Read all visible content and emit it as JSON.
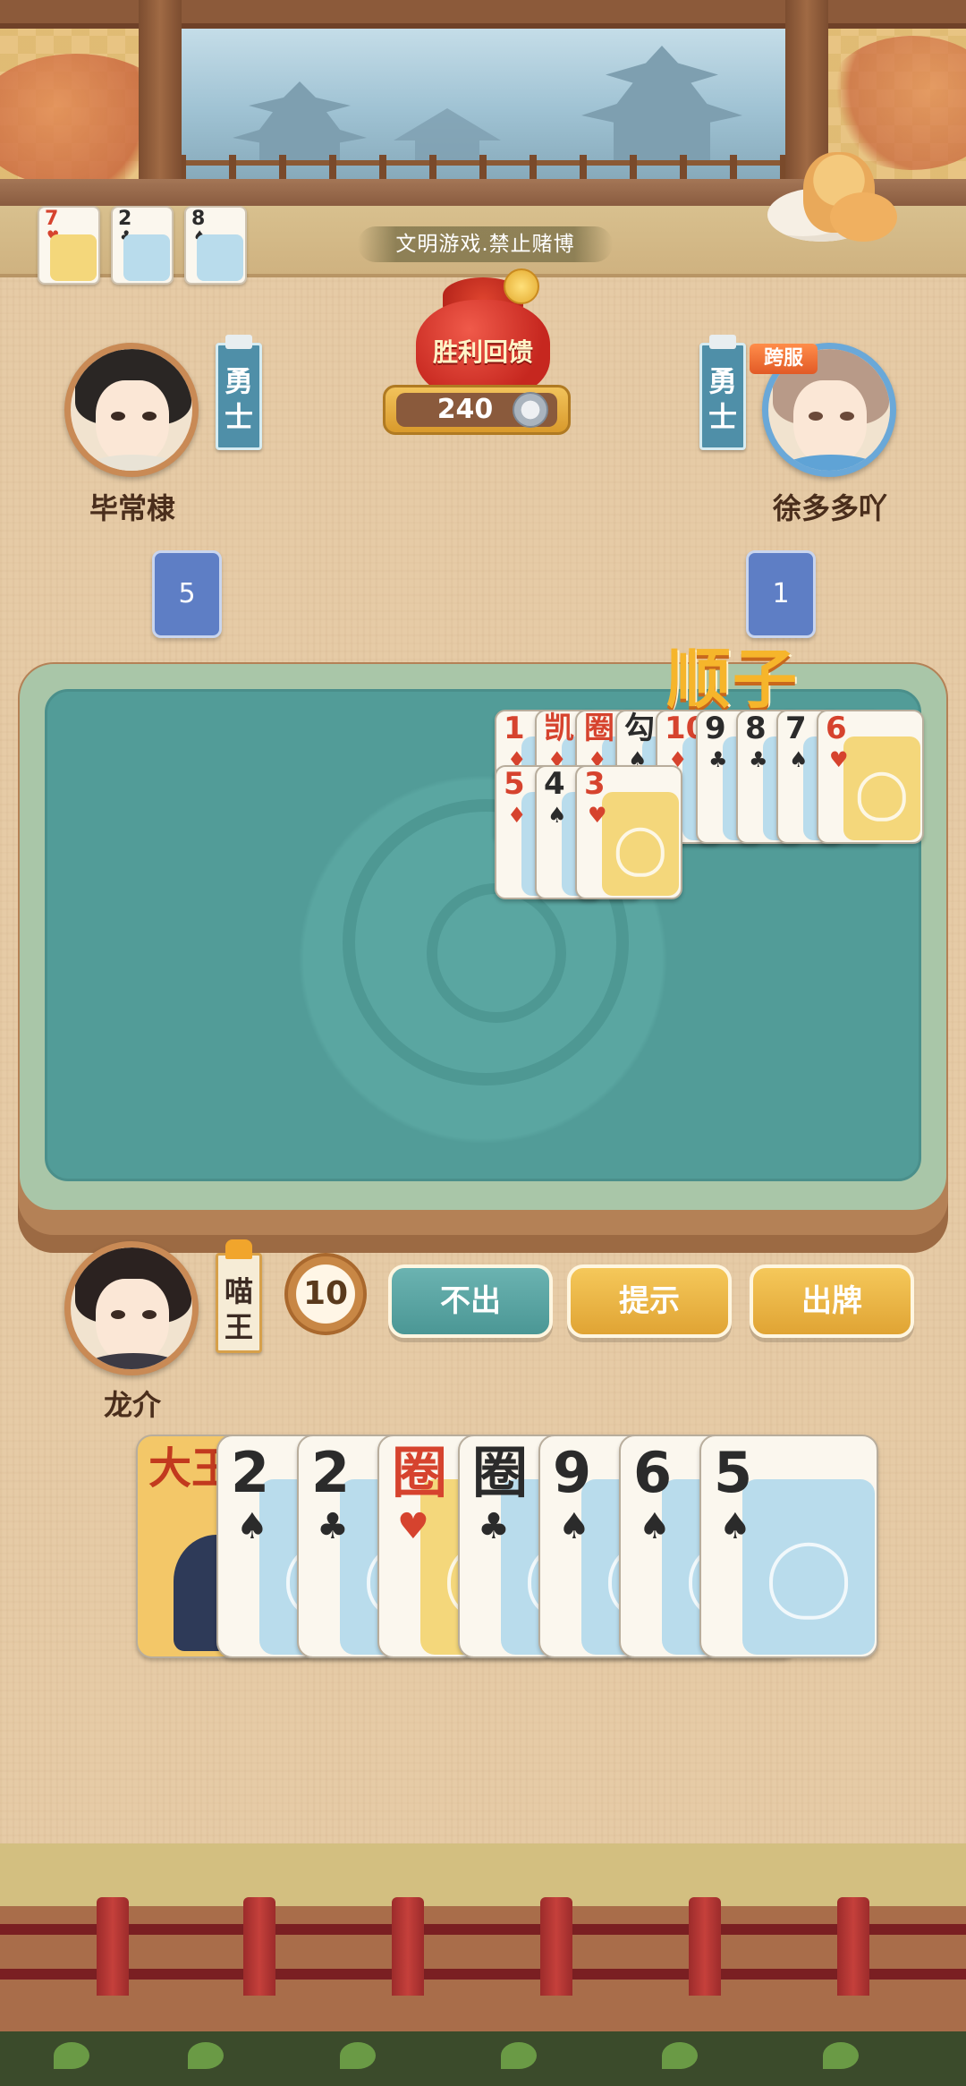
{
  "notice": "文明游戏.禁止赌博",
  "pot": {
    "label": "胜利回馈",
    "amount": "240"
  },
  "recent_cards": [
    {
      "rank": "7",
      "suit": "♥",
      "color": "red",
      "art": "gold"
    },
    {
      "rank": "2",
      "suit": "♣",
      "color": "black",
      "art": "blue"
    },
    {
      "rank": "8",
      "suit": "♠",
      "color": "black",
      "art": "blue"
    }
  ],
  "players": {
    "left": {
      "name": "毕常棣",
      "rank": "勇士",
      "cards_left": "5"
    },
    "right": {
      "name": "徐多多吖",
      "rank": "勇士",
      "badge": "跨服",
      "cards_left": "1"
    },
    "self": {
      "name": "龙介",
      "rank": "喵王"
    }
  },
  "table": {
    "combo_label": "顺子",
    "played_cards": [
      {
        "rank": "1",
        "suit": "♦",
        "color": "red"
      },
      {
        "rank": "凯",
        "suit": "♦",
        "color": "red"
      },
      {
        "rank": "圈",
        "suit": "♦",
        "color": "red"
      },
      {
        "rank": "勾",
        "suit": "♠",
        "color": "black"
      },
      {
        "rank": "10",
        "suit": "♦",
        "color": "red"
      },
      {
        "rank": "9",
        "suit": "♣",
        "color": "black"
      },
      {
        "rank": "8",
        "suit": "♣",
        "color": "black"
      },
      {
        "rank": "7",
        "suit": "♠",
        "color": "black"
      },
      {
        "rank": "6",
        "suit": "♥",
        "color": "red",
        "art": "gold"
      },
      {
        "rank": "5",
        "suit": "♦",
        "color": "red"
      },
      {
        "rank": "4",
        "suit": "♠",
        "color": "black"
      },
      {
        "rank": "3",
        "suit": "♥",
        "color": "red",
        "art": "gold"
      }
    ]
  },
  "timer": "10",
  "actions": {
    "pass": "不出",
    "hint": "提示",
    "play": "出牌"
  },
  "hand": [
    {
      "rank": "大王",
      "joker": true
    },
    {
      "rank": "2",
      "suit": "♠",
      "color": "black",
      "art": "blue"
    },
    {
      "rank": "2",
      "suit": "♣",
      "color": "black",
      "art": "blue"
    },
    {
      "rank": "圈",
      "suit": "♥",
      "color": "red",
      "art": "gold"
    },
    {
      "rank": "圈",
      "suit": "♣",
      "color": "black",
      "art": "blue"
    },
    {
      "rank": "9",
      "suit": "♠",
      "color": "black",
      "art": "blue"
    },
    {
      "rank": "6",
      "suit": "♠",
      "color": "black",
      "art": "blue"
    },
    {
      "rank": "5",
      "suit": "♠",
      "color": "black",
      "art": "blue"
    }
  ]
}
